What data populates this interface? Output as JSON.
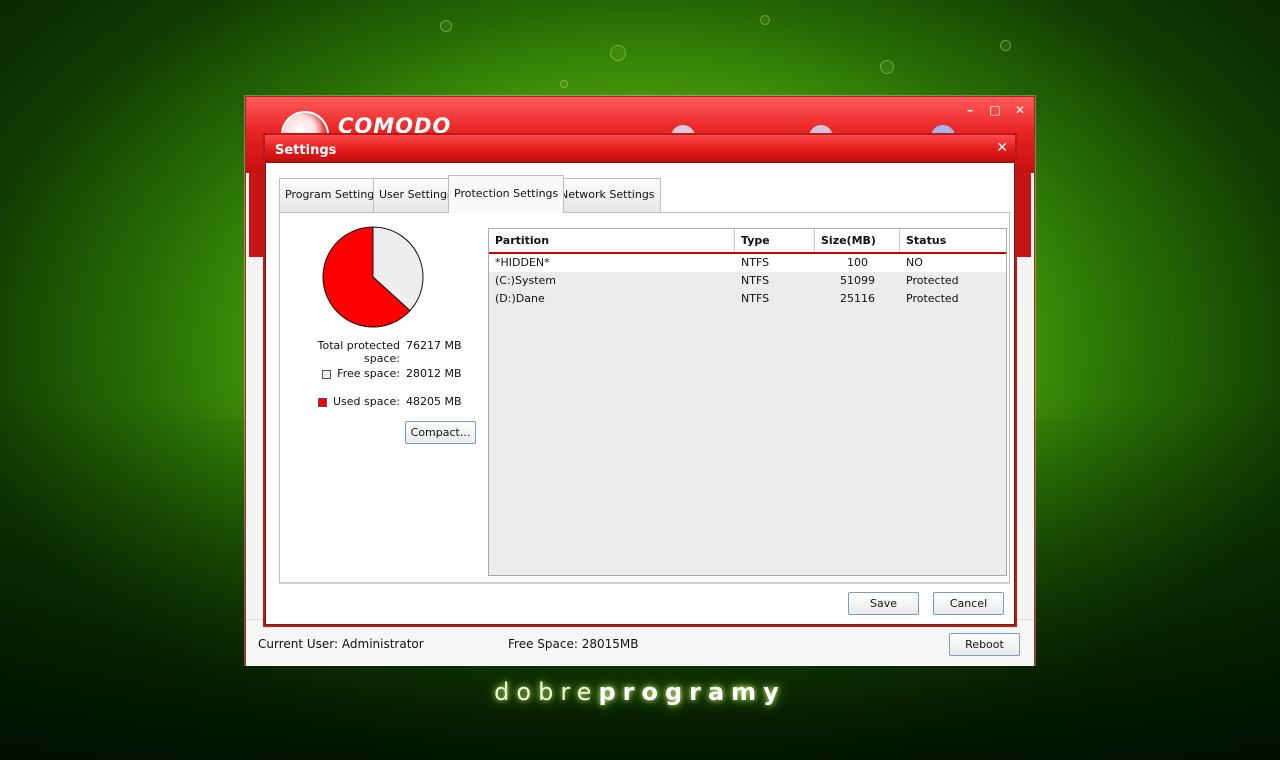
{
  "app": {
    "brand": "COMODO",
    "window_controls": {
      "minimize": "–",
      "maximize": "□",
      "close": "✕"
    }
  },
  "status_bar": {
    "current_user": "Current User: Administrator",
    "free_space": "Free Space: 28015MB",
    "reboot_label": "Reboot"
  },
  "dialog": {
    "title": "Settings",
    "close": "✕",
    "tabs": [
      {
        "label": "Program Settings",
        "active": false
      },
      {
        "label": "User Settings",
        "active": false
      },
      {
        "label": "Protection Settings",
        "active": true
      },
      {
        "label": "Network Settings",
        "active": false
      }
    ],
    "save_label": "Save",
    "cancel_label": "Cancel"
  },
  "protection": {
    "total_label": "Total protected space:",
    "total_value": "76217 MB",
    "free_label": "Free space:",
    "free_value": "28012 MB",
    "used_label": "Used space:",
    "used_value": "48205 MB",
    "compact_label": "Compact...",
    "pie": {
      "used_mb": 48205,
      "free_mb": 28012,
      "used_color": "#ff0000",
      "free_color": "#eeeeee"
    }
  },
  "partitions": {
    "columns": [
      "Partition",
      "Type",
      "Size(MB)",
      "Status"
    ],
    "rows": [
      [
        "*HIDDEN*",
        "NTFS",
        "100",
        "NO"
      ],
      [
        "(C:)System",
        "NTFS",
        "51099",
        "Protected"
      ],
      [
        "(D:)Dane",
        "NTFS",
        "25116",
        "Protected"
      ]
    ]
  },
  "footer_brand": {
    "light": "dobre",
    "bold": "programy"
  }
}
